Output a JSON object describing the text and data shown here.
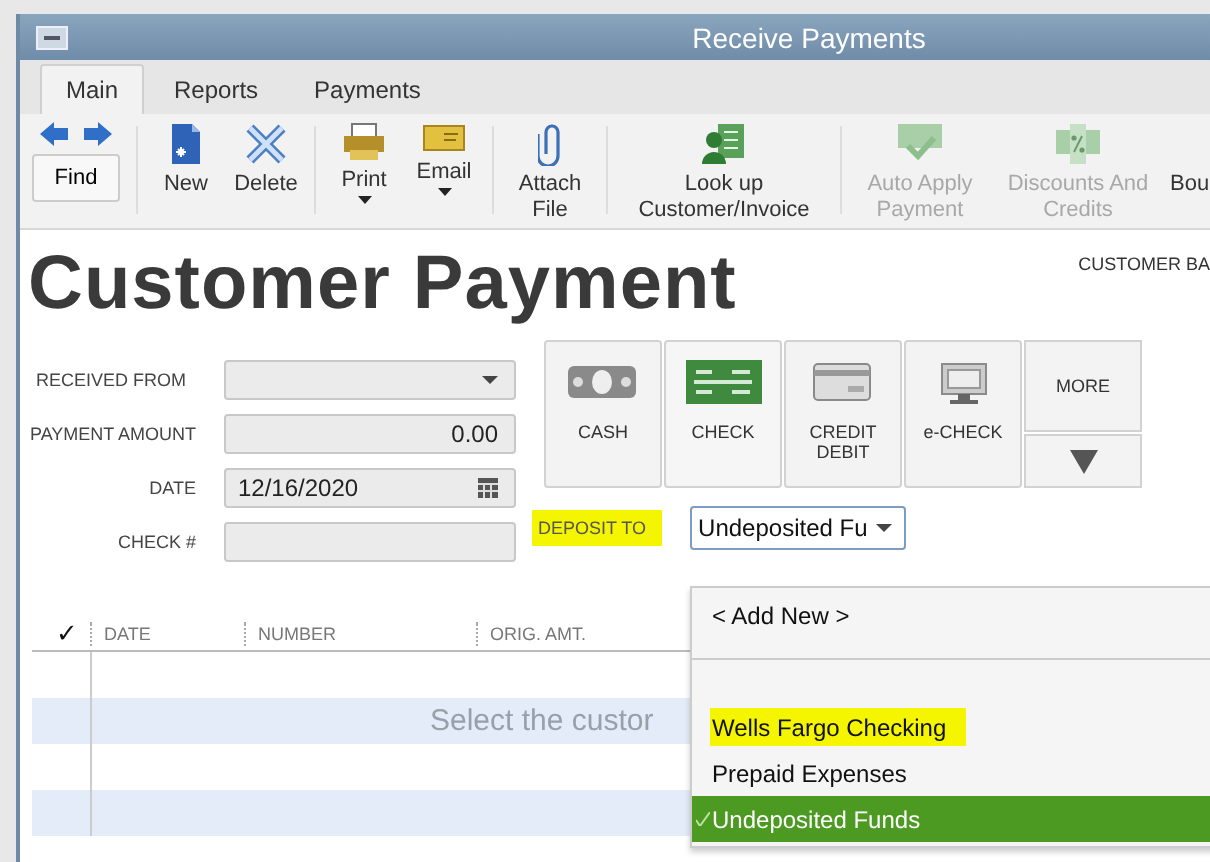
{
  "window": {
    "title": "Receive Payments"
  },
  "tabs": [
    {
      "label": "Main",
      "selected": true
    },
    {
      "label": "Reports",
      "selected": false
    },
    {
      "label": "Payments",
      "selected": false
    }
  ],
  "toolbar": [
    {
      "kind": "find",
      "label": "Find",
      "disabled": false
    },
    {
      "kind": "new",
      "label": "New",
      "disabled": false
    },
    {
      "kind": "delete",
      "label": "Delete",
      "disabled": false
    },
    {
      "kind": "print",
      "label": "Print",
      "disabled": false,
      "dropdown": true
    },
    {
      "kind": "email",
      "label": "Email",
      "disabled": false,
      "dropdown": true
    },
    {
      "kind": "attach",
      "label": "Attach File",
      "disabled": false
    },
    {
      "kind": "lookup",
      "label": "Look up Customer/Invoice",
      "disabled": false
    },
    {
      "kind": "autoapply",
      "label": "Auto Apply Payment",
      "disabled": true
    },
    {
      "kind": "discounts",
      "label": "Discounts And Credits",
      "disabled": true
    },
    {
      "kind": "cut",
      "label": "Bou",
      "disabled": false
    }
  ],
  "heading": "Customer Payment",
  "balance_label": "CUSTOMER BA",
  "form": [
    {
      "label": "RECEIVED FROM",
      "kind": "dropdown"
    },
    {
      "label": "PAYMENT AMOUNT",
      "kind": "amount",
      "value": "0.00"
    },
    {
      "label": "DATE",
      "kind": "date",
      "value": "12/16/2020"
    },
    {
      "label": "CHECK #",
      "kind": "text"
    }
  ],
  "payment_methods": [
    {
      "kind": "cash",
      "label": "CASH",
      "selected": false
    },
    {
      "kind": "check",
      "label": "CHECK",
      "selected": true
    },
    {
      "kind": "card",
      "label": "CREDIT DEBIT",
      "selected": false
    },
    {
      "kind": "echeck",
      "label": "e-CHECK",
      "selected": false
    }
  ],
  "more_button": {
    "label": "MORE"
  },
  "deposit_to": {
    "label": "DEPOSIT TO",
    "highlighted": true,
    "value": "Undeposited Fu"
  },
  "dropdown_menu": [
    {
      "kind": "action",
      "label": "< Add New >",
      "selected": false,
      "highlighted": false
    },
    {
      "kind": "separator"
    },
    {
      "kind": "account",
      "label": "Wells Fargo Checking",
      "selected": false,
      "highlighted": true
    },
    {
      "kind": "account",
      "label": "Prepaid Expenses",
      "selected": false,
      "highlighted": false
    },
    {
      "kind": "account",
      "label": "Undeposited Funds",
      "selected": true,
      "highlighted": false
    }
  ],
  "table": {
    "check_header": "✓",
    "columns": [
      "DATE",
      "NUMBER",
      "ORIG. AMT."
    ],
    "placeholder": "Select the custor"
  }
}
